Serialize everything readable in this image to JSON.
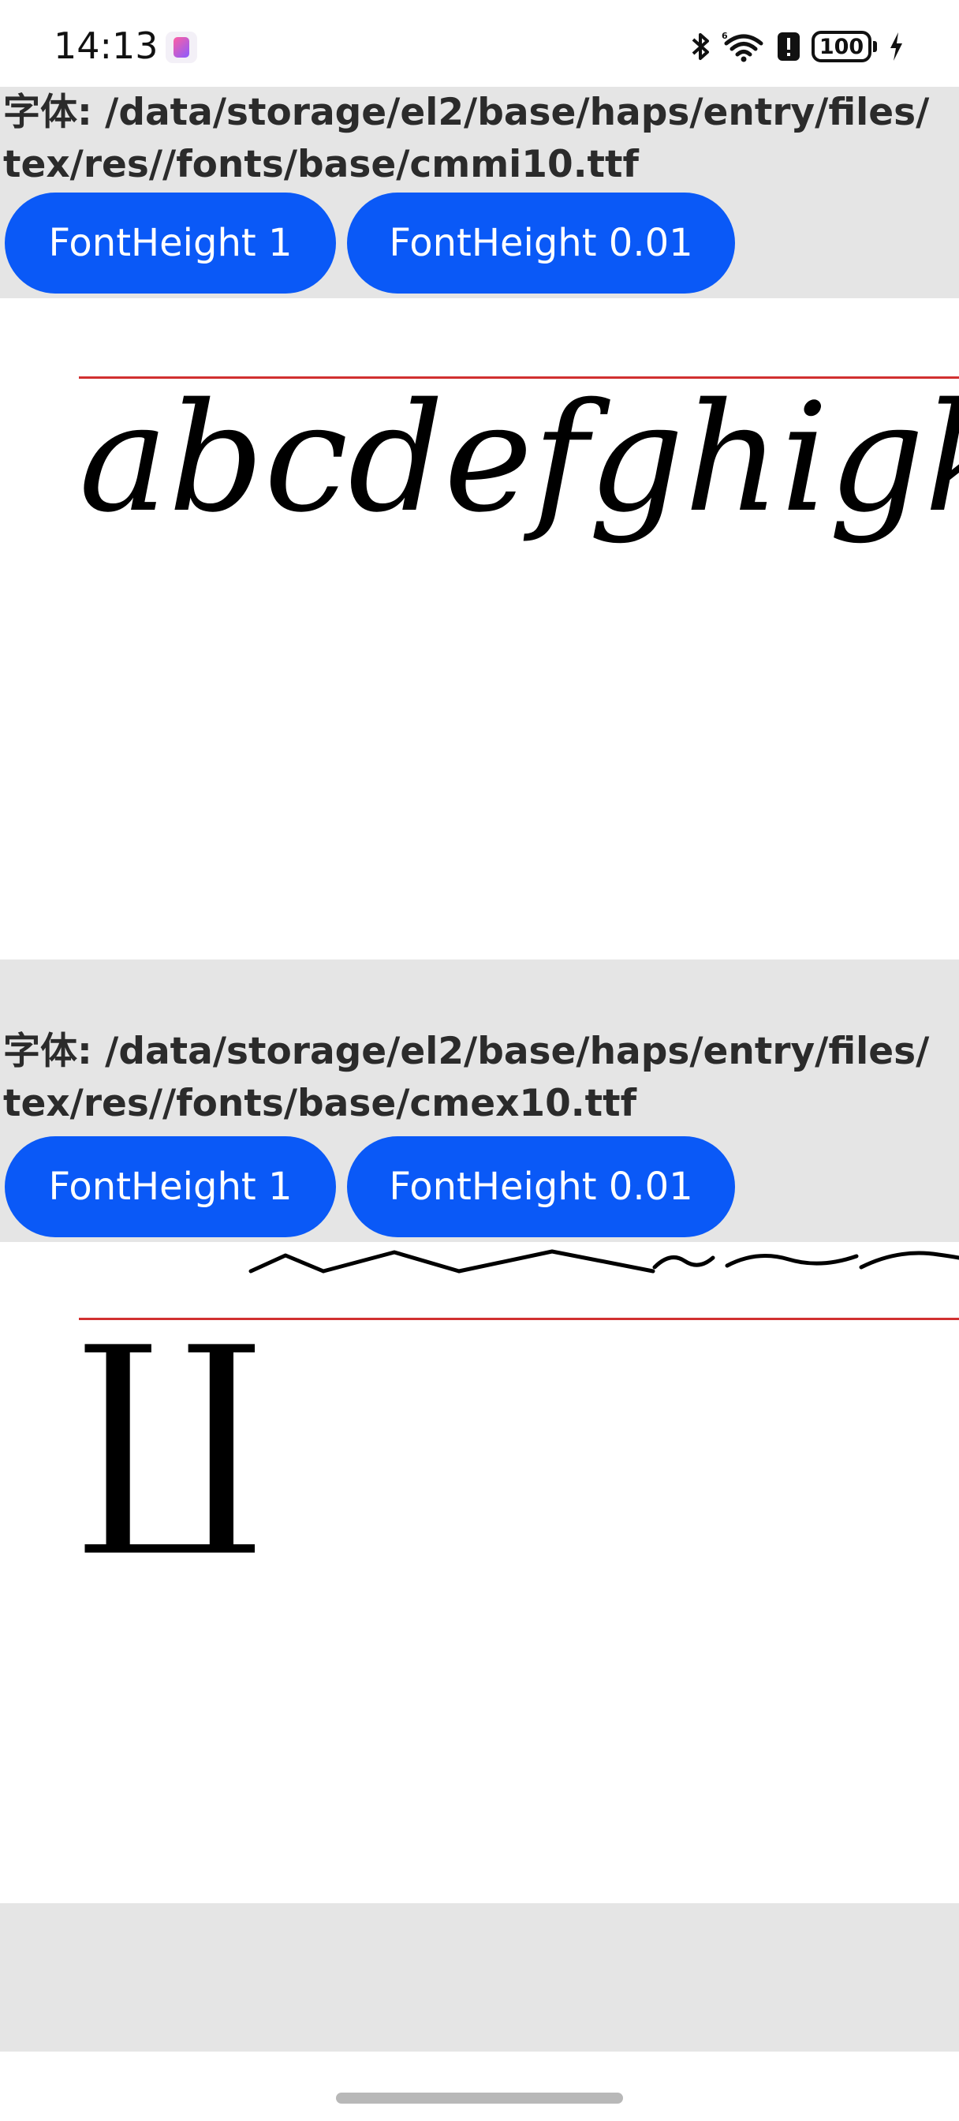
{
  "status_bar": {
    "time": "14:13",
    "battery_level": "100",
    "icons": [
      "bluetooth-icon",
      "wifi-icon",
      "alert-icon",
      "battery-icon",
      "charging-icon"
    ]
  },
  "sections": [
    {
      "font_path_line1": "字体: /data/storage/el2/base/haps/entry/files/",
      "font_path_line2": "tex/res//fonts/base/cmmi10.ttf",
      "button_1": "FontHeight 1",
      "button_2": "FontHeight 0.01",
      "sample_text": "abcdefghigklmn"
    },
    {
      "font_path_line1": "字体: /data/storage/el2/base/haps/entry/files/",
      "font_path_line2": "tex/res//fonts/base/cmex10.ttf",
      "button_1": "FontHeight 1",
      "button_2": "FontHeight 0.01",
      "sample_text": "∐"
    }
  ],
  "colors": {
    "button_bg": "#0a59f7",
    "header_bg": "#e5e5e5",
    "baseline": "#d13030"
  }
}
